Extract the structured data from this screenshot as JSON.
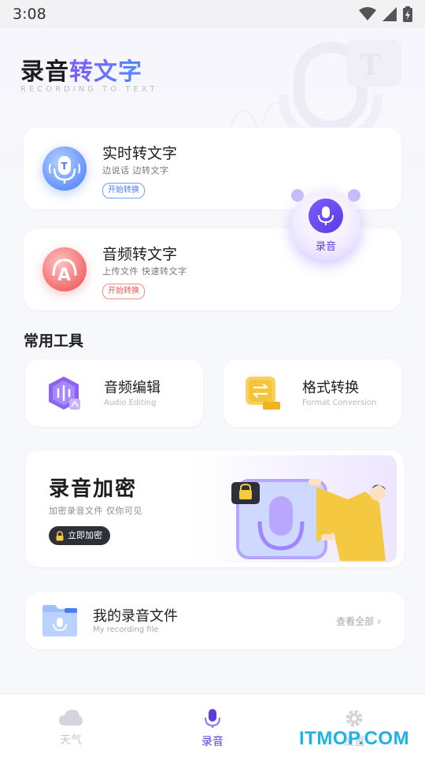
{
  "status_bar": {
    "time": "3:08"
  },
  "header": {
    "title_part1": "录音",
    "title_part2": "转文字",
    "subtitle": "RECORDING TO TEXT"
  },
  "features": [
    {
      "title": "实时转文字",
      "desc": "边说话  边转文字",
      "button": "开始转换",
      "icon": "microphone-t-icon",
      "color": "#4a7cf5"
    },
    {
      "title": "音频转文字",
      "desc": "上传文件  快速转文字",
      "button": "开始转换",
      "icon": "audio-a-icon",
      "color": "#f15b5b"
    }
  ],
  "record_fab": {
    "label": "录音",
    "icon": "microphone-icon",
    "color": "#5b3ce0"
  },
  "tools": {
    "section_title": "常用工具",
    "items": [
      {
        "title": "音频编辑",
        "subtitle": "Audio Editing",
        "icon": "audio-edit-icon",
        "color": "#8b63f0"
      },
      {
        "title": "格式转换",
        "subtitle": "Format Conversion",
        "icon": "format-convert-icon",
        "color": "#f3c43c"
      }
    ]
  },
  "banner": {
    "title": "录音加密",
    "desc": "加密录音文件  仅你可见",
    "button": "立即加密"
  },
  "files": {
    "title": "我的录音文件",
    "subtitle": "My recording file",
    "view_all": "查看全部"
  },
  "bottom_nav": [
    {
      "label": "天气",
      "icon": "cloud-icon",
      "active": false
    },
    {
      "label": "录音",
      "icon": "microphone-icon",
      "active": true
    },
    {
      "label": "设置",
      "icon": "gear-icon",
      "active": false
    }
  ],
  "watermark": "ITMOP.COM"
}
